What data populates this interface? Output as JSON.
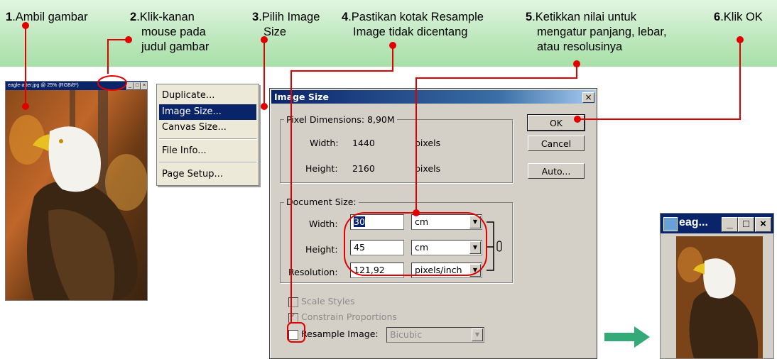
{
  "steps": [
    {
      "num": "1",
      "text": "Ambil gambar"
    },
    {
      "num": "2",
      "lines": [
        "Klik-kanan",
        "mouse pada",
        "judul gambar"
      ]
    },
    {
      "num": "3",
      "lines": [
        "Pilih Image",
        "Size"
      ]
    },
    {
      "num": "4",
      "lines": [
        "Pastikan kotak Resample",
        "Image tidak dicentang"
      ]
    },
    {
      "num": "5",
      "lines": [
        "Ketikkan nilai untuk",
        "mengatur panjang, lebar,",
        "atau resolusinya"
      ]
    },
    {
      "num": "6",
      "text": "Klik OK"
    }
  ],
  "photo_window": {
    "title": "eagle-after.jpg @ 25% (RGB/8*)"
  },
  "context_menu": {
    "items": [
      "Duplicate...",
      "Image Size...",
      "Canvas Size...",
      "File Info...",
      "Page Setup..."
    ],
    "selected": "Image Size..."
  },
  "dialog": {
    "title": "Image Size",
    "close": "×",
    "pixel_dimensions": {
      "label": "Pixel Dimensions:",
      "size": "8,90M",
      "width_label": "Width:",
      "width_value": "1440",
      "width_unit": "pixels",
      "height_label": "Height:",
      "height_value": "2160",
      "height_unit": "pixels"
    },
    "document_size": {
      "label": "Document Size:",
      "width_label": "Width:",
      "width_value": "30",
      "width_unit": "cm",
      "height_label": "Height:",
      "height_value": "45",
      "height_unit": "cm",
      "resolution_label": "Resolution:",
      "resolution_value": "121,92",
      "resolution_unit": "pixels/inch"
    },
    "buttons": {
      "ok": "OK",
      "cancel": "Cancel",
      "auto": "Auto..."
    },
    "checkboxes": {
      "scale_styles": "Scale Styles",
      "constrain_proportions": "Constrain Proportions",
      "resample_image": "Resample Image:",
      "resample_method": "Bicubic"
    }
  },
  "small_window": {
    "title": "eag...",
    "min": "_",
    "max": "□",
    "close": "×"
  },
  "colors": {
    "banner": "#bfe8bf",
    "callout": "#e00000",
    "arrow": "#33aa77",
    "titlebar": "#0a246a"
  }
}
